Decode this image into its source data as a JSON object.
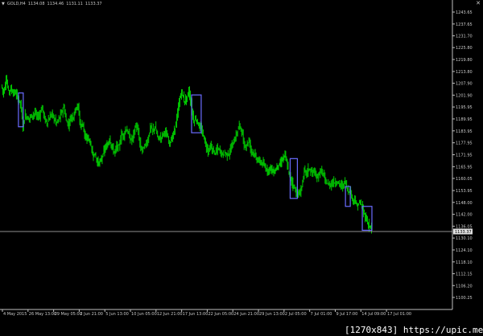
{
  "chart": {
    "header": {
      "arrow": "▼",
      "symbol": "GOLD,H4",
      "open": "1134.08",
      "high": "1134.46",
      "low": "1131.11",
      "close": "1133.37"
    },
    "close_icon": "✕",
    "current_price": "1133.37",
    "price_scale": [
      "1243.65",
      "1237.65",
      "1231.70",
      "1225.80",
      "1219.80",
      "1213.80",
      "1207.90",
      "1201.90",
      "1195.95",
      "1189.95",
      "1183.95",
      "1177.95",
      "1171.95",
      "1165.95",
      "1160.05",
      "1153.95",
      "1148.00",
      "1142.00",
      "1136.05",
      "1130.10",
      "1124.10",
      "1118.10",
      "1112.15",
      "1106.20",
      "1100.25"
    ],
    "time_scale": [
      "4 May 2015",
      "26 May 13:00",
      "29 May 05:00",
      "2 Jun 21:00",
      "5 Jun 13:00",
      "10 Jun 05:00",
      "12 Jun 21:00",
      "17 Jun 13:00",
      "22 Jun 05:00",
      "24 Jun 21:00",
      "29 Jun 13:00",
      "2 Jul 05:00",
      "7 Jul 01:00",
      "9 Jul 17:00",
      "14 Jul 09:00",
      "17 Jul 01:00"
    ],
    "colors": {
      "background": "#000000",
      "candle": "#00c800",
      "box": "#6a6cff",
      "price_line": "#c0c0c0",
      "text": "#c8c8c8"
    }
  },
  "chart_data": {
    "type": "candlestick",
    "symbol": "GOLD",
    "timeframe": "H4",
    "ylim": [
      1100.25,
      1243.65
    ],
    "close_path": [
      [
        0,
        1207
      ],
      [
        3,
        1203
      ],
      [
        6,
        1210
      ],
      [
        9,
        1204
      ],
      [
        12,
        1205
      ],
      [
        15,
        1203
      ],
      [
        18,
        1203
      ],
      [
        21,
        1200
      ],
      [
        24,
        1198
      ],
      [
        27,
        1186
      ],
      [
        30,
        1192
      ],
      [
        33,
        1190
      ],
      [
        36,
        1191
      ],
      [
        39,
        1192
      ],
      [
        42,
        1193
      ],
      [
        45,
        1191
      ],
      [
        48,
        1192
      ],
      [
        51,
        1196
      ],
      [
        54,
        1190
      ],
      [
        57,
        1188
      ],
      [
        60,
        1190
      ],
      [
        63,
        1193
      ],
      [
        66,
        1190
      ],
      [
        69,
        1188
      ],
      [
        72,
        1190
      ],
      [
        75,
        1193
      ],
      [
        78,
        1196
      ],
      [
        81,
        1189
      ],
      [
        84,
        1187
      ],
      [
        87,
        1191
      ],
      [
        90,
        1191
      ],
      [
        93,
        1196
      ],
      [
        96,
        1196
      ],
      [
        99,
        1186
      ],
      [
        102,
        1188
      ],
      [
        105,
        1179
      ],
      [
        108,
        1181
      ],
      [
        111,
        1178
      ],
      [
        114,
        1172
      ],
      [
        117,
        1172
      ],
      [
        120,
        1168
      ],
      [
        123,
        1168
      ],
      [
        126,
        1171
      ],
      [
        129,
        1175
      ],
      [
        132,
        1176
      ],
      [
        135,
        1180
      ],
      [
        138,
        1176
      ],
      [
        141,
        1173
      ],
      [
        144,
        1176
      ],
      [
        147,
        1176
      ],
      [
        150,
        1182
      ],
      [
        153,
        1182
      ],
      [
        156,
        1185
      ],
      [
        159,
        1182
      ],
      [
        162,
        1179
      ],
      [
        165,
        1182
      ],
      [
        168,
        1187
      ],
      [
        171,
        1183
      ],
      [
        174,
        1175
      ],
      [
        177,
        1175
      ],
      [
        180,
        1177
      ],
      [
        183,
        1179
      ],
      [
        186,
        1186
      ],
      [
        189,
        1184
      ],
      [
        192,
        1186
      ],
      [
        195,
        1181
      ],
      [
        198,
        1180
      ],
      [
        201,
        1182
      ],
      [
        204,
        1184
      ],
      [
        207,
        1181
      ],
      [
        210,
        1178
      ],
      [
        213,
        1180
      ],
      [
        216,
        1184
      ],
      [
        219,
        1190
      ],
      [
        222,
        1198
      ],
      [
        225,
        1204
      ],
      [
        228,
        1199
      ],
      [
        231,
        1200
      ],
      [
        234,
        1204
      ],
      [
        237,
        1197
      ],
      [
        240,
        1189
      ],
      [
        243,
        1190
      ],
      [
        246,
        1187
      ],
      [
        249,
        1185
      ],
      [
        252,
        1182
      ],
      [
        255,
        1177
      ],
      [
        258,
        1174
      ],
      [
        261,
        1176
      ],
      [
        264,
        1174
      ],
      [
        267,
        1173
      ],
      [
        270,
        1175
      ],
      [
        273,
        1174
      ],
      [
        276,
        1172
      ],
      [
        279,
        1173
      ],
      [
        282,
        1172
      ],
      [
        285,
        1173
      ],
      [
        288,
        1177
      ],
      [
        291,
        1179
      ],
      [
        294,
        1183
      ],
      [
        297,
        1187
      ],
      [
        300,
        1184
      ],
      [
        303,
        1176
      ],
      [
        306,
        1177
      ],
      [
        309,
        1179
      ],
      [
        312,
        1174
      ],
      [
        315,
        1173
      ],
      [
        318,
        1170
      ],
      [
        321,
        1169
      ],
      [
        324,
        1168
      ],
      [
        327,
        1167
      ],
      [
        330,
        1165
      ],
      [
        333,
        1164
      ],
      [
        336,
        1166
      ],
      [
        339,
        1163
      ],
      [
        342,
        1164
      ],
      [
        345,
        1167
      ],
      [
        348,
        1167
      ],
      [
        351,
        1170
      ],
      [
        354,
        1172
      ],
      [
        357,
        1166
      ],
      [
        360,
        1161
      ],
      [
        363,
        1158
      ],
      [
        366,
        1155
      ],
      [
        369,
        1152
      ],
      [
        372,
        1152
      ],
      [
        375,
        1156
      ],
      [
        378,
        1164
      ],
      [
        381,
        1163
      ],
      [
        384,
        1165
      ],
      [
        387,
        1163
      ],
      [
        390,
        1164
      ],
      [
        393,
        1160
      ],
      [
        396,
        1162
      ],
      [
        399,
        1164
      ],
      [
        402,
        1162
      ],
      [
        405,
        1158
      ],
      [
        408,
        1157
      ],
      [
        411,
        1157
      ],
      [
        414,
        1158
      ],
      [
        417,
        1158
      ],
      [
        420,
        1158
      ],
      [
        423,
        1157
      ],
      [
        426,
        1156
      ],
      [
        429,
        1159
      ],
      [
        432,
        1154
      ],
      [
        435,
        1154
      ],
      [
        438,
        1150
      ],
      [
        441,
        1149
      ],
      [
        444,
        1146
      ],
      [
        447,
        1148
      ],
      [
        450,
        1146
      ],
      [
        453,
        1142
      ],
      [
        456,
        1139
      ],
      [
        459,
        1136
      ],
      [
        462,
        1135
      ]
    ],
    "current_price": 1133.37
  }
}
